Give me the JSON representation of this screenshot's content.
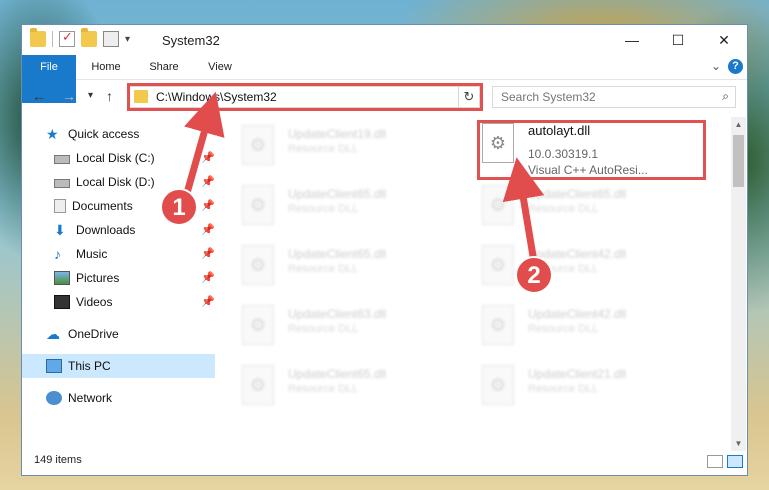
{
  "window": {
    "title": "System32",
    "controls": {
      "minimize": "—",
      "maximize": "☐",
      "close": "✕"
    }
  },
  "ribbon": {
    "tabs": [
      {
        "label": "File"
      },
      {
        "label": "Home"
      },
      {
        "label": "Share"
      },
      {
        "label": "View"
      }
    ]
  },
  "address": {
    "path": "C:\\Windows\\System32"
  },
  "search": {
    "placeholder": "Search System32"
  },
  "sidebar": {
    "items": [
      {
        "label": "Quick access",
        "icon": "star-icon"
      },
      {
        "label": "Local Disk (C:)",
        "icon": "drive-icon",
        "pinned": true
      },
      {
        "label": "Local Disk (D:)",
        "icon": "drive-icon",
        "pinned": true
      },
      {
        "label": "Documents",
        "icon": "documents-icon",
        "pinned": true
      },
      {
        "label": "Downloads",
        "icon": "download-icon",
        "pinned": true
      },
      {
        "label": "Music",
        "icon": "music-icon",
        "pinned": true
      },
      {
        "label": "Pictures",
        "icon": "pictures-icon",
        "pinned": true
      },
      {
        "label": "Videos",
        "icon": "videos-icon",
        "pinned": true
      },
      {
        "label": "OneDrive",
        "icon": "cloud-icon"
      },
      {
        "label": "This PC",
        "icon": "computer-icon",
        "selected": true
      },
      {
        "label": "Network",
        "icon": "network-icon"
      }
    ]
  },
  "files": {
    "featured": {
      "name": "autolayt.dll",
      "version": "10.0.30319.1",
      "description": "Visual C++ AutoResi..."
    },
    "left": [
      {
        "name": "UpdateClient19.dll",
        "type": "Resource DLL"
      },
      {
        "name": "UpdateClient65.dll",
        "type": "Resource DLL"
      },
      {
        "name": "UpdateClient65.dll",
        "type": "Resource DLL"
      },
      {
        "name": "UpdateClient63.dll",
        "type": "Resource DLL"
      },
      {
        "name": "UpdateClient65.dll",
        "type": "Resource DLL"
      }
    ],
    "right": [
      {
        "name": "UpdateClient65.dll",
        "type": "Resource DLL"
      },
      {
        "name": "UpdateClient42.dll",
        "type": "Resource DLL"
      },
      {
        "name": "UpdateClient42.dll",
        "type": "Resource DLL"
      },
      {
        "name": "UpdateClient21.dll",
        "type": "Resource DLL"
      }
    ]
  },
  "status": {
    "count": "149 items"
  },
  "callouts": {
    "one": "1",
    "two": "2"
  },
  "colors": {
    "accent": "#1979ca",
    "highlight": "#e05252",
    "selected": "#cce8ff"
  }
}
